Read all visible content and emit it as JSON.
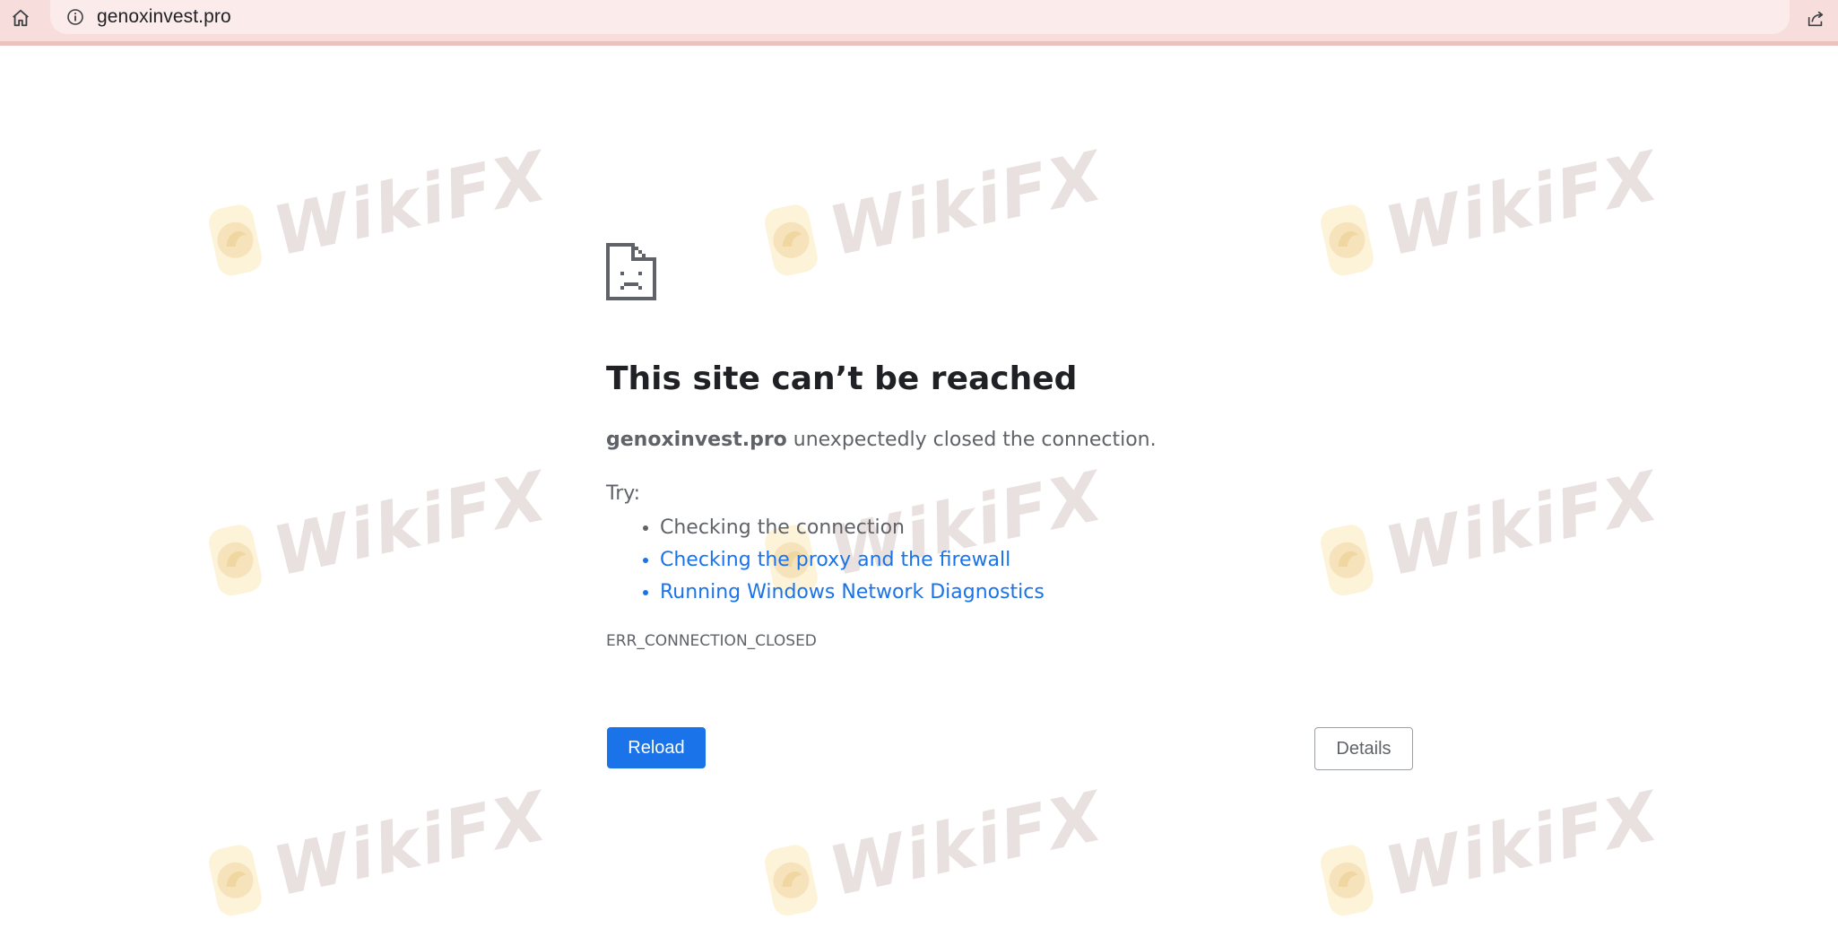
{
  "browser": {
    "url": "genoxinvest.pro",
    "icons": {
      "home": "home-icon",
      "site_info": "info-icon",
      "share": "share-icon"
    },
    "toolbar_color": "#f7dedc"
  },
  "error_page": {
    "icon": "sad-page-icon",
    "title": "This site can’t be reached",
    "host": "genoxinvest.pro",
    "message_suffix": " unexpectedly closed the connection.",
    "try_label": "Try:",
    "suggestions": [
      {
        "label": "Checking the connection",
        "is_link": false
      },
      {
        "label": "Checking the proxy and the firewall",
        "is_link": true
      },
      {
        "label": "Running Windows Network Diagnostics",
        "is_link": true
      }
    ],
    "error_code": "ERR_CONNECTION_CLOSED",
    "reload_label": "Reload",
    "details_label": "Details",
    "accent_color": "#1a73e8"
  },
  "watermark": {
    "text": "WikiFX",
    "logo": "wikifx-logo"
  }
}
